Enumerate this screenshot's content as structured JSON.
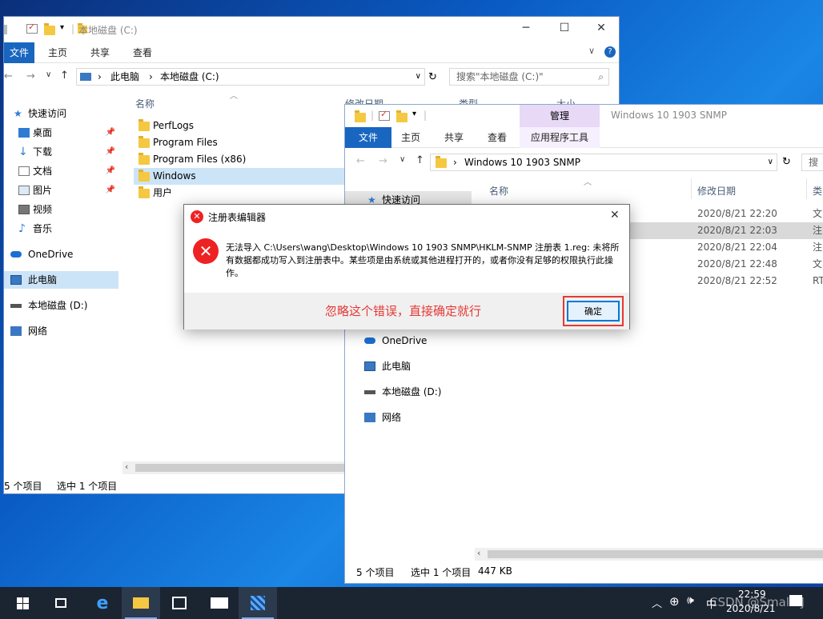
{
  "back_window": {
    "title": "本地磁盘 (C:)",
    "tabs": [
      "文件",
      "主页",
      "共享",
      "查看"
    ],
    "breadcrumb": [
      "此电脑",
      "本地磁盘 (C:)"
    ],
    "search_placeholder": "搜索\"本地磁盘 (C:)\"",
    "nav": {
      "quick_access": "快速访问",
      "items": [
        "桌面",
        "下载",
        "文档",
        "图片",
        "视频",
        "音乐"
      ],
      "onedrive": "OneDrive",
      "this_pc": "此电脑",
      "drive_d": "本地磁盘 (D:)",
      "network": "网络"
    },
    "columns": [
      "名称",
      "修改日期",
      "类型",
      "大小"
    ],
    "files": [
      "PerfLogs",
      "Program Files",
      "Program Files (x86)",
      "Windows",
      "用户"
    ],
    "status_count": "5 个项目",
    "status_selected": "选中 1 个项目"
  },
  "front_window": {
    "title": "Windows 10  1903 SNMP",
    "tabs": [
      "文件",
      "主页",
      "共享",
      "查看"
    ],
    "manage_tab": "管理",
    "app_tools_tab": "应用程序工具",
    "breadcrumb": "Windows 10  1903 SNMP",
    "search_placeholder": "搜",
    "nav": {
      "quick_access": "快速访问",
      "onedrive": "OneDrive",
      "this_pc": "此电脑",
      "drive_d": "本地磁盘 (D:)",
      "network": "网络"
    },
    "columns": [
      "名称",
      "修改日期",
      "类"
    ],
    "rows": [
      {
        "date": "2020/8/21 22:20",
        "type": "文"
      },
      {
        "date": "2020/8/21 22:03",
        "type": "注"
      },
      {
        "date": "2020/8/21 22:04",
        "type": "注"
      },
      {
        "date": "2020/8/21 22:48",
        "type": "文"
      },
      {
        "date": "2020/8/21 22:52",
        "type": "RT"
      }
    ],
    "status_count": "5 个项目",
    "status_selected": "选中 1 个项目",
    "status_size": "447 KB"
  },
  "dialog": {
    "title": "注册表编辑器",
    "message": "无法导入 C:\\Users\\wang\\Desktop\\Windows 10  1903 SNMP\\HKLM-SNMP 注册表 1.reg: 未将所有数据都成功写入到注册表中。某些项是由系统或其他进程打开的，或者你没有足够的权限执行此操作。",
    "annotation": "忽略这个错误，直接确定就行",
    "ok_label": "确定"
  },
  "taskbar": {
    "ime": "中",
    "time": "22:59",
    "date": "2020/8/21",
    "watermark": "CSDN @SmallZJ"
  },
  "colors": {
    "accent": "#1966c0",
    "manage_tab": "#e8d9f7",
    "annotation_red": "#e53935",
    "error_red": "#e22222"
  }
}
